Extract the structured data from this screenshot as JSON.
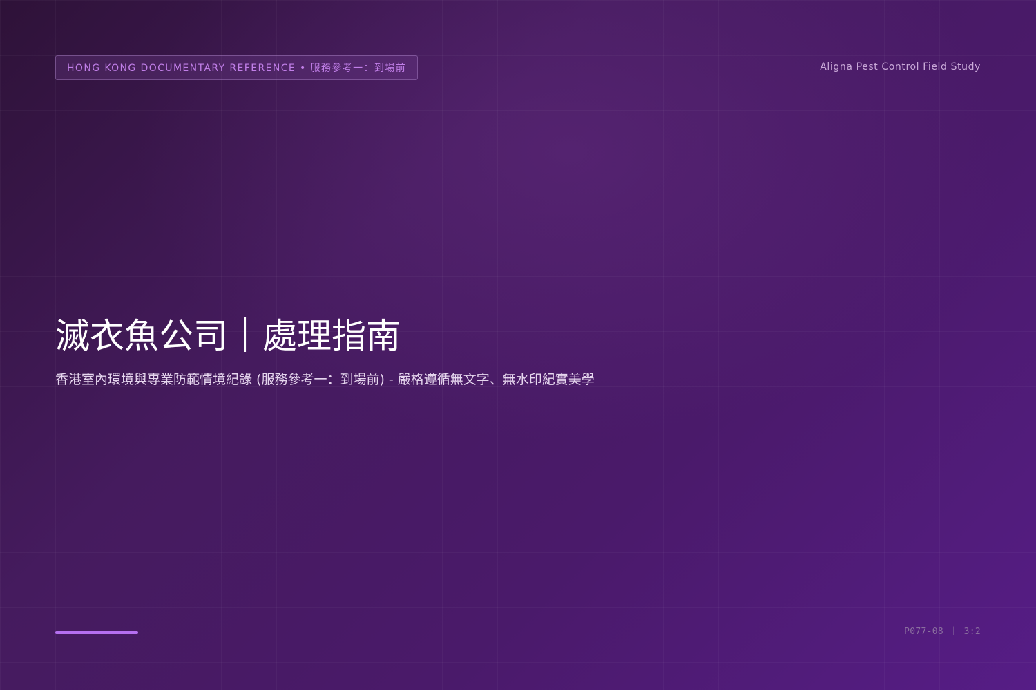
{
  "header": {
    "badge": "HONG KONG DOCUMENTARY REFERENCE • 服務參考一：到場前",
    "brand": "Aligna Pest Control Field Study"
  },
  "hero": {
    "title": "滅衣魚公司｜處理指南",
    "subtitle": "香港室內環境與專業防範情境紀錄 (服務參考一：到場前) - 嚴格遵循無文字、無水印紀實美學"
  },
  "footer": {
    "code": "P077-08 ｜ 3:2"
  },
  "colors": {
    "accent": "#b56ff0",
    "badge_text": "#c17fe8",
    "background_start": "#2e1238",
    "background_end": "#561d86"
  }
}
